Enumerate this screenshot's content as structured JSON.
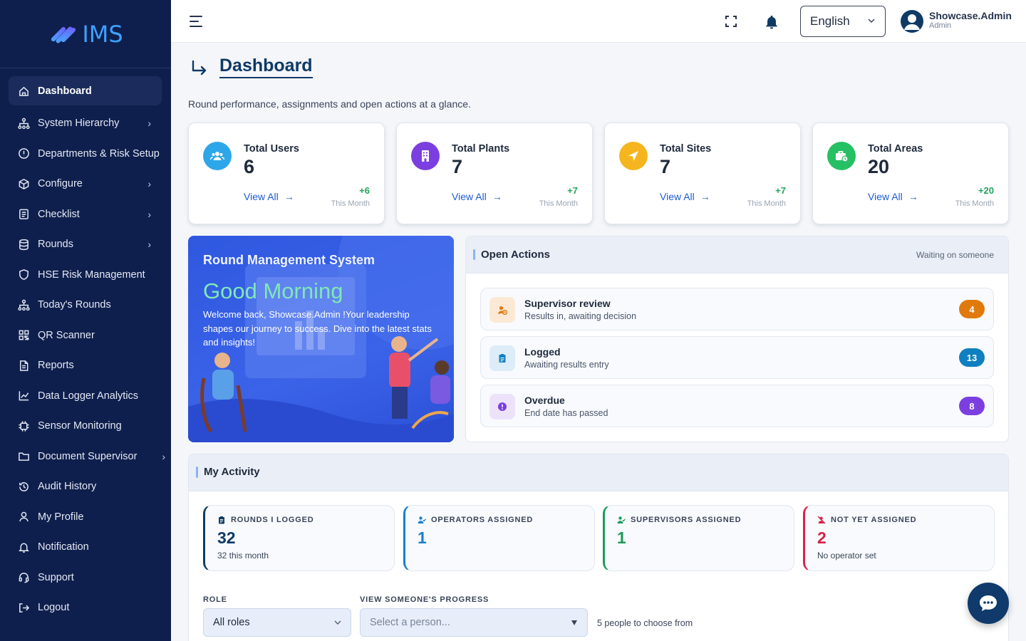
{
  "app": {
    "logo_text": "IMS"
  },
  "sidebar": {
    "items": [
      {
        "label": "Dashboard",
        "icon": "home-icon",
        "chevron": false
      },
      {
        "label": "System Hierarchy",
        "icon": "hierarchy-icon",
        "chevron": true
      },
      {
        "label": "Departments & Risk Setup",
        "icon": "alert-circle-icon",
        "chevron": false
      },
      {
        "label": "Configure",
        "icon": "cube-icon",
        "chevron": true
      },
      {
        "label": "Checklist",
        "icon": "checklist-icon",
        "chevron": true
      },
      {
        "label": "Rounds",
        "icon": "database-icon",
        "chevron": true
      },
      {
        "label": "HSE Risk Management",
        "icon": "shield-icon",
        "chevron": false
      },
      {
        "label": "Today's Rounds",
        "icon": "hierarchy-icon",
        "chevron": false
      },
      {
        "label": "QR Scanner",
        "icon": "qr-icon",
        "chevron": false
      },
      {
        "label": "Reports",
        "icon": "document-icon",
        "chevron": false
      },
      {
        "label": "Data Logger Analytics",
        "icon": "line-chart-icon",
        "chevron": false
      },
      {
        "label": "Sensor Monitoring",
        "icon": "chip-icon",
        "chevron": false
      },
      {
        "label": "Document Supervisor",
        "icon": "folder-icon",
        "chevron": true
      },
      {
        "label": "Audit History",
        "icon": "history-icon",
        "chevron": false
      },
      {
        "label": "My Profile",
        "icon": "user-icon",
        "chevron": false
      },
      {
        "label": "Notification",
        "icon": "bell-icon",
        "chevron": false
      },
      {
        "label": "Support",
        "icon": "headset-icon",
        "chevron": false
      },
      {
        "label": "Logout",
        "icon": "logout-icon",
        "chevron": false
      }
    ]
  },
  "topbar": {
    "language": "English",
    "user_name": "Showcase.Admin",
    "user_role": "Admin"
  },
  "page": {
    "title": "Dashboard",
    "subtitle": "Round performance, assignments and open actions at a glance."
  },
  "stats": [
    {
      "label": "Total Users",
      "value": "6",
      "link": "View All",
      "delta": "+6",
      "period": "This Month",
      "color": "#2ea6ea",
      "icon": "users-icon"
    },
    {
      "label": "Total Plants",
      "value": "7",
      "link": "View All",
      "delta": "+7",
      "period": "This Month",
      "color": "#7b3fe0",
      "icon": "building-icon"
    },
    {
      "label": "Total Sites",
      "value": "7",
      "link": "View All",
      "delta": "+7",
      "period": "This Month",
      "color": "#f5b51e",
      "icon": "location-arrow-icon"
    },
    {
      "label": "Total Areas",
      "value": "20",
      "link": "View All",
      "delta": "+20",
      "period": "This Month",
      "color": "#25c063",
      "icon": "toolbox-icon"
    }
  ],
  "hero": {
    "title": "Round Management System",
    "greeting": "Good Morning",
    "text": "Welcome back, Showcase.Admin !Your leadership shapes our journey to success. Dive into the latest stats and insights!"
  },
  "open_actions": {
    "title": "Open Actions",
    "note": "Waiting on someone",
    "items": [
      {
        "title": "Supervisor review",
        "sub": "Results in, awaiting decision",
        "count": "4",
        "badge_color": "#e07a0c",
        "icon_bg": "#fbe9d6",
        "icon_color": "#e07a0c",
        "icon": "user-clock-icon"
      },
      {
        "title": "Logged",
        "sub": "Awaiting results entry",
        "count": "13",
        "badge_color": "#0e7fc0",
        "icon_bg": "#dcecf8",
        "icon_color": "#0e7fc0",
        "icon": "clipboard-icon"
      },
      {
        "title": "Overdue",
        "sub": "End date has passed",
        "count": "8",
        "badge_color": "#7b3fe0",
        "icon_bg": "#ece3fb",
        "icon_color": "#7b3fe0",
        "icon": "exclamation-icon"
      }
    ]
  },
  "activity": {
    "title": "My Activity",
    "cards": [
      {
        "label": "ROUNDS I LOGGED",
        "value": "32",
        "sub": "32 this month",
        "color": "#0f3a66",
        "icon": "clipboard-icon"
      },
      {
        "label": "OPERATORS ASSIGNED",
        "value": "1",
        "sub": "",
        "color": "#1880c8",
        "icon": "user-check-icon"
      },
      {
        "label": "SUPERVISORS ASSIGNED",
        "value": "1",
        "sub": "",
        "color": "#1e9a5a",
        "icon": "user-check-icon"
      },
      {
        "label": "NOT YET ASSIGNED",
        "value": "2",
        "sub": "No operator set",
        "color": "#d8234a",
        "icon": "user-slash-icon"
      }
    ],
    "role_label": "ROLE",
    "role_value": "All roles",
    "person_label": "VIEW SOMEONE'S PROGRESS",
    "person_placeholder": "Select a person...",
    "people_note": "5 people to choose from"
  }
}
